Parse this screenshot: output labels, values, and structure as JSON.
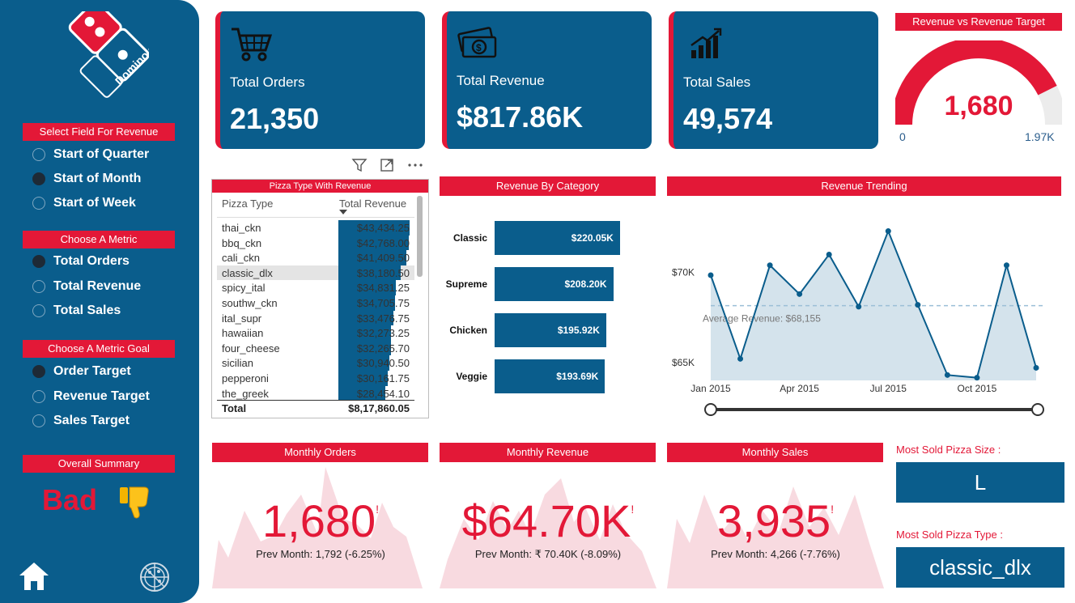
{
  "sidebar": {
    "brand": "Domino's Pizza",
    "revenue_field": {
      "header": "Select Field For Revenue",
      "options": [
        "Start of Quarter",
        "Start of Month",
        "Start of Week"
      ],
      "selected": "Start of Month"
    },
    "metric": {
      "header": "Choose A Metric",
      "options": [
        "Total Orders",
        "Total Revenue",
        "Total Sales"
      ],
      "selected": "Total Orders"
    },
    "metric_goal": {
      "header": "Choose A Metric Goal",
      "options": [
        "Order Target",
        "Revenue Target",
        "Sales Target"
      ],
      "selected": "Order Target"
    },
    "summary": {
      "header": "Overall Summary",
      "value": "Bad",
      "icon": "thumbs-down-icon"
    },
    "icons": [
      "home-icon",
      "pizza-icon"
    ]
  },
  "kpis": [
    {
      "label": "Total Orders",
      "value": "21,350",
      "icon": "shopping-cart-icon"
    },
    {
      "label": "Total Revenue",
      "value": "$817.86K",
      "icon": "money-icon"
    },
    {
      "label": "Total Sales",
      "value": "49,574",
      "icon": "bar-growth-icon"
    }
  ],
  "gauge": {
    "title": "Revenue vs Revenue Target",
    "value": "1,680",
    "min": "0",
    "max": "1.97K",
    "fraction": 0.853,
    "color": "#e31837"
  },
  "pizza_table": {
    "title": "Pizza Type With Revenue",
    "columns": [
      "Pizza Type",
      "Total Revenue"
    ],
    "rows": [
      {
        "name": "thai_ckn",
        "revenue": "$43,434.25",
        "value": 43434.25
      },
      {
        "name": "bbq_ckn",
        "revenue": "$42,768.00",
        "value": 42768.0
      },
      {
        "name": "cali_ckn",
        "revenue": "$41,409.50",
        "value": 41409.5
      },
      {
        "name": "classic_dlx",
        "revenue": "$38,180.50",
        "value": 38180.5
      },
      {
        "name": "spicy_ital",
        "revenue": "$34,831.25",
        "value": 34831.25
      },
      {
        "name": "southw_ckn",
        "revenue": "$34,705.75",
        "value": 34705.75
      },
      {
        "name": "ital_supr",
        "revenue": "$33,476.75",
        "value": 33476.75
      },
      {
        "name": "hawaiian",
        "revenue": "$32,273.25",
        "value": 32273.25
      },
      {
        "name": "four_cheese",
        "revenue": "$32,265.70",
        "value": 32265.7
      },
      {
        "name": "sicilian",
        "revenue": "$30,940.50",
        "value": 30940.5
      },
      {
        "name": "pepperoni",
        "revenue": "$30,161.75",
        "value": 30161.75
      },
      {
        "name": "the_greek",
        "revenue": "$28,454.10",
        "value": 28454.1
      }
    ],
    "highlighted": "classic_dlx",
    "total_label": "Total",
    "total_value": "$8,17,860.05"
  },
  "visual_tools": [
    "filter-icon",
    "focus-mode-icon",
    "more-options-icon"
  ],
  "chart_data": [
    {
      "type": "bar",
      "title": "Revenue By Category",
      "orientation": "horizontal",
      "categories": [
        "Classic",
        "Supreme",
        "Chicken",
        "Veggie"
      ],
      "values": [
        220.05,
        208.2,
        195.92,
        193.69
      ],
      "labels": [
        "$220.05K",
        "$208.20K",
        "$195.92K",
        "$193.69K"
      ],
      "xlim": [
        0,
        270
      ]
    },
    {
      "type": "area",
      "title": "Revenue Trending",
      "x": [
        "2015-01",
        "2015-02",
        "2015-03",
        "2015-04",
        "2015-05",
        "2015-06",
        "2015-07",
        "2015-08",
        "2015-09",
        "2015-10",
        "2015-11",
        "2015-12"
      ],
      "values": [
        69850,
        65200,
        70400,
        68800,
        71000,
        68100,
        72300,
        68200,
        64300,
        64150,
        70400,
        64700
      ],
      "x_tick_labels": [
        "Jan 2015",
        "Apr 2015",
        "Jul 2015",
        "Oct 2015"
      ],
      "y_tick_labels": [
        "$65K",
        "$70K"
      ],
      "ylim": [
        64000,
        73000
      ],
      "average_line": {
        "value": 68155,
        "label": "Average Revenue: $68,155"
      },
      "color": "#0a5d8c",
      "slider": true
    }
  ],
  "monthly": [
    {
      "title": "Monthly Orders",
      "value": "1,680",
      "flag": "!",
      "prev": "Prev Month: 1,792 (-6.25%)"
    },
    {
      "title": "Monthly Revenue",
      "value": "$64.70K",
      "flag": "!",
      "prev": "Prev Month: ₹ 70.40K (-8.09%)"
    },
    {
      "title": "Monthly Sales",
      "value": "3,935",
      "flag": "!",
      "prev": "Prev Month: 4,266 (-7.76%)"
    }
  ],
  "most_sold": {
    "size_label": "Most Sold Pizza Size :",
    "size_value": "L",
    "type_label": "Most Sold Pizza Type :",
    "type_value": "classic_dlx"
  },
  "colors": {
    "brand_blue": "#0a5d8c",
    "brand_red": "#e31837"
  }
}
